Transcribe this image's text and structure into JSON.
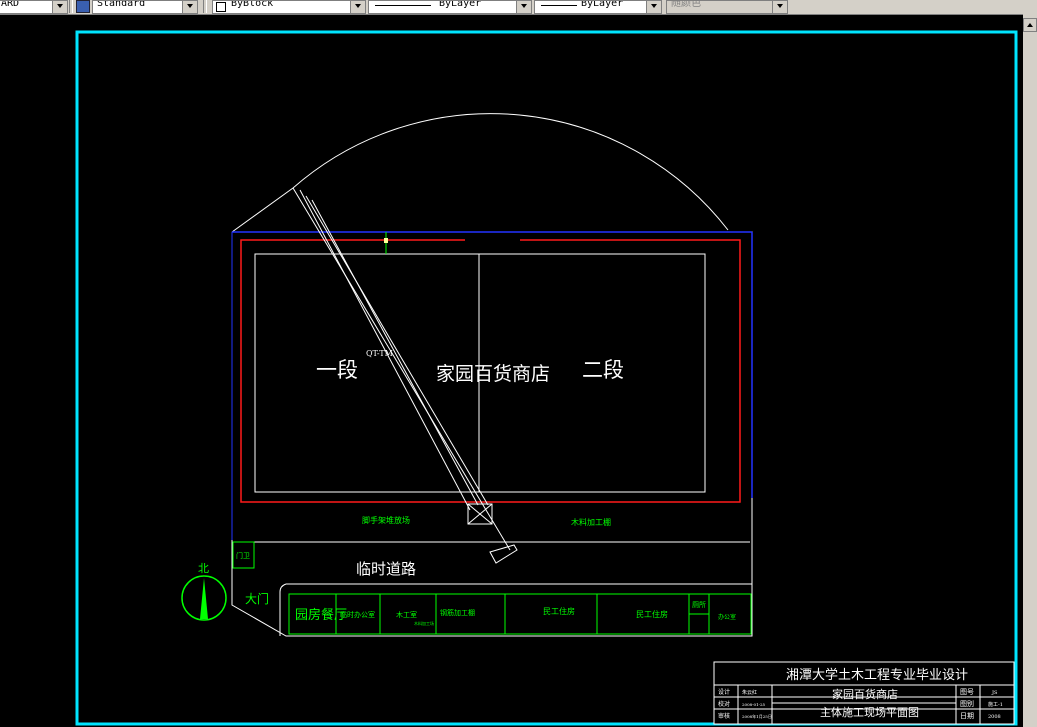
{
  "toolbar": {
    "layer_value": "ARD",
    "textstyle_value": "Standard",
    "color_value": "ByBlock",
    "linetype_value": "ByLayer",
    "lineweight_value": "ByLayer",
    "plotstyle_value": "随颜色"
  },
  "drawing": {
    "store_name": "家园百货商店",
    "section_one": "一段",
    "section_two": "二段",
    "crane_label": "QT-TM",
    "temp_road": "临时道路",
    "north_label": "北",
    "gate_label": "大门",
    "guard_label": "门卫",
    "scaffold_label": "脚手架堆放场",
    "timber_label": "木料加工棚",
    "buildings": [
      "园房餐厅",
      "临时办公室",
      "木工室",
      "钢筋加工棚",
      "民工住房",
      "民工住房",
      "厕所",
      "办公室"
    ],
    "wood_note": "木料加工场"
  },
  "title_block": {
    "university": "湘潭大学土木工程专业毕业设计",
    "project": "家园百货商店",
    "drawing_name": "主体施工现场平面图",
    "left_labels": [
      "设计",
      "校对",
      "审核",
      "审定"
    ],
    "left_values": [
      "朱云红",
      "2008-01-25",
      "2008年1月25日"
    ],
    "right_labels": [
      "图号",
      "图别",
      "日期"
    ],
    "right_values": [
      "JS",
      "施工-1",
      "2008"
    ]
  },
  "colors": {
    "background": "#000000",
    "frame": "#00e5ff",
    "site_line": "#ffffff",
    "building_line": "#00ff00",
    "red_line": "#ff0000",
    "blue_line": "#0000ff"
  }
}
